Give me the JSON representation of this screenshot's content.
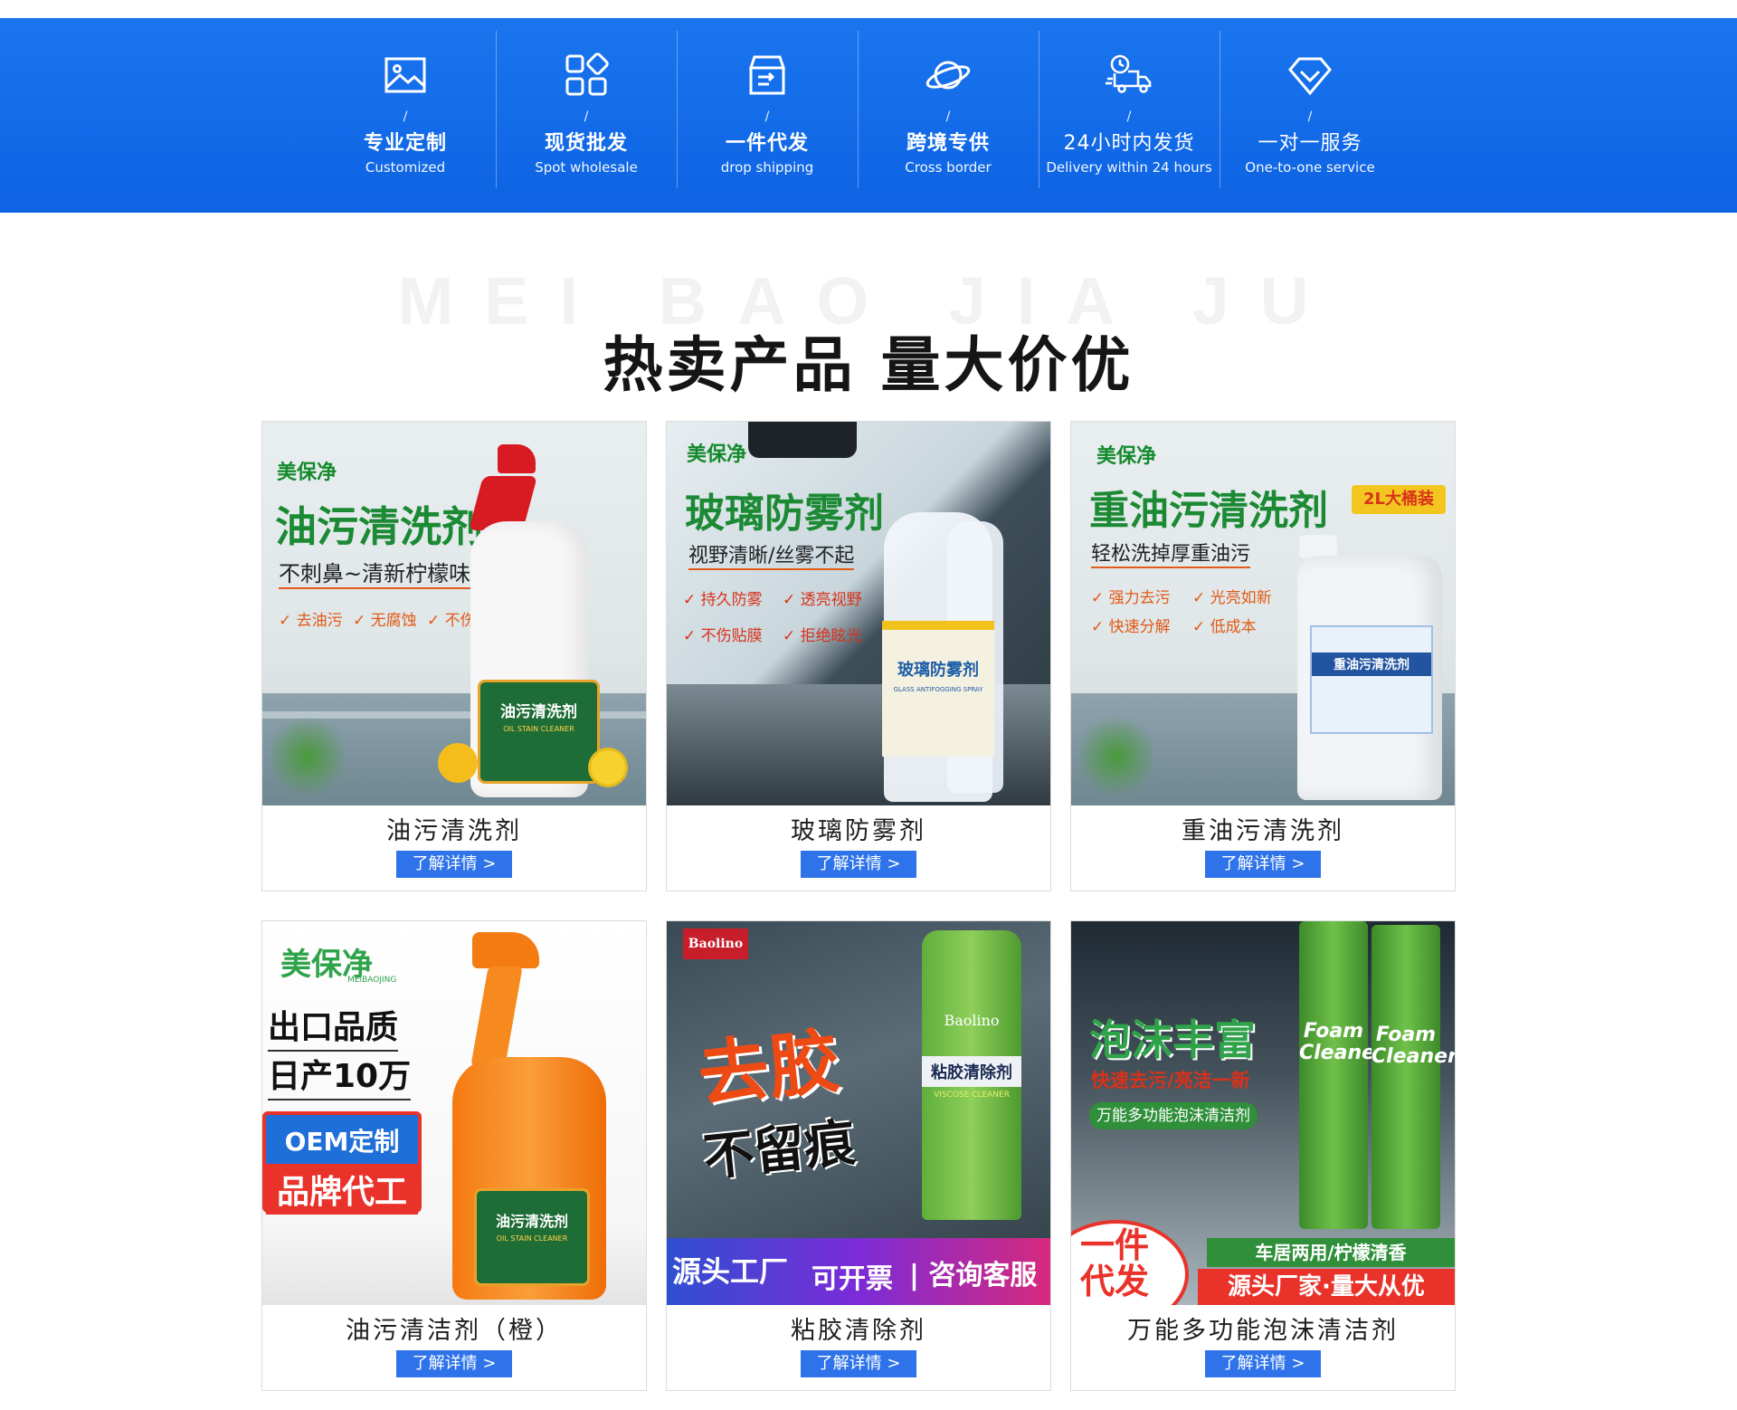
{
  "features": [
    {
      "icon": "image-icon",
      "slash": "/",
      "cn": "专业定制",
      "en": "Customized"
    },
    {
      "icon": "grid-icon",
      "slash": "/",
      "cn": "现货批发",
      "en": "Spot wholesale"
    },
    {
      "icon": "box-icon",
      "slash": "/",
      "cn": "一件代发",
      "en": "drop shipping"
    },
    {
      "icon": "planet-icon",
      "slash": "/",
      "cn": "跨境专供",
      "en": "Cross border"
    },
    {
      "icon": "truck-icon",
      "slash": "/",
      "cn": "24小时内发货",
      "en": "Delivery within 24 hours"
    },
    {
      "icon": "diamond-icon",
      "slash": "/",
      "cn": "一对一服务",
      "en": "One-to-one service"
    }
  ],
  "section": {
    "watermark": "MEI BAO JIA JU",
    "heading": "热卖产品 量大价优"
  },
  "products": [
    {
      "title": "油污清洗剂",
      "button": "了解详情 >",
      "img": {
        "logo": "美保净",
        "headline": "油污清洗剂",
        "sub": "不刺鼻~清新柠檬味",
        "checks": [
          "去油污",
          "无腐蚀",
          "不伤手"
        ],
        "label": "油污清洗剂",
        "label_en": "OIL STAIN CLEANER"
      }
    },
    {
      "title": "玻璃防雾剂",
      "button": "了解详情 >",
      "img": {
        "logo": "美保净",
        "headline": "玻璃防雾剂",
        "sub": "视野清晰/丝雾不起",
        "checks": [
          "持久防雾",
          "透亮视野",
          "不伤贴膜",
          "拒绝眩光"
        ],
        "label": "玻璃防雾剂",
        "label_en": "GLASS ANTIFOGGING SPRAY"
      }
    },
    {
      "title": "重油污清洗剂",
      "button": "了解详情 >",
      "img": {
        "logo": "美保净",
        "headline": "重油污清洗剂",
        "tag": "2L大桶装",
        "sub": "轻松洗掉厚重油污",
        "checks": [
          "强力去污",
          "光亮如新",
          "快速分解",
          "低成本"
        ],
        "label": "重油污清洗剂"
      }
    },
    {
      "title": "油污清洁剂（橙）",
      "button": "了解详情 >",
      "img": {
        "logo": "美保净",
        "logo_en": "MEIBAOJING",
        "line1": "出口品质",
        "line2": "日产10万",
        "oem": "OEM定制",
        "brand": "品牌代工",
        "label": "油污清洗剂",
        "label_en": "OIL STAIN CLEANER"
      }
    },
    {
      "title": "粘胶清除剂",
      "button": "了解详情 >",
      "img": {
        "logo": "Baolino",
        "big1": "去胶",
        "big2": "不留痕",
        "can": "粘胶清除剂",
        "can_en": "VISCOSE CLEANER",
        "banner1": "源头工厂",
        "banner2": "可开票",
        "banner3": "咨询客服"
      }
    },
    {
      "title": "万能多功能泡沫清洁剂",
      "button": "了解详情 >",
      "img": {
        "headline": "泡沫丰富",
        "sub1": "快速去污/亮洁一新",
        "sub2": "万能多功能泡沫清洁剂",
        "can_en": "Foam Cleaner",
        "corner": "一件代发",
        "bar1": "车居两用/柠檬清香",
        "bar2": "源头厂家·量大从优"
      }
    }
  ]
}
